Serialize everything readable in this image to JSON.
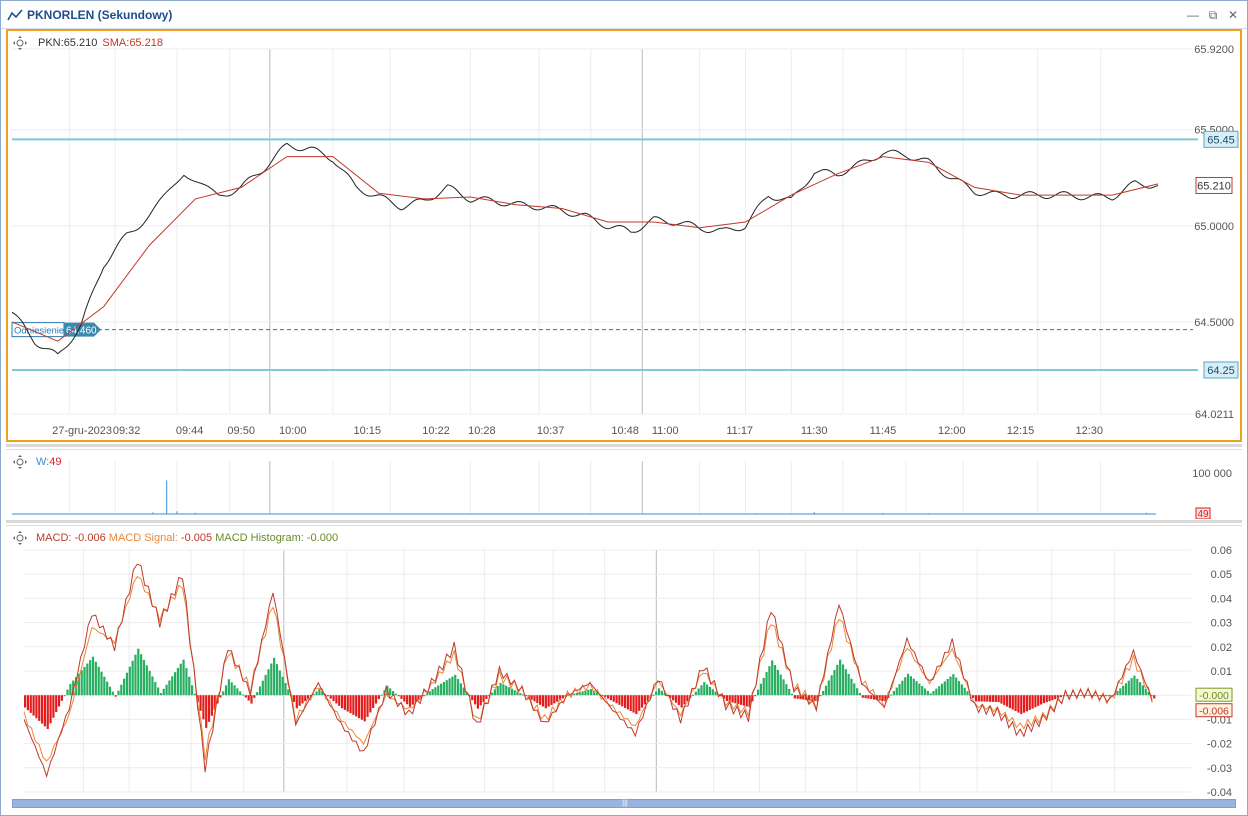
{
  "window": {
    "title": "PKNORLEN (Sekundowy)",
    "minimize": "—",
    "restore": "⧉",
    "close": "✕"
  },
  "colors": {
    "price_line": "#222222",
    "sma_line": "#c0392b",
    "hline": "#7ec8d8",
    "ref_line": "#2a7ab0",
    "panel_border": "#f0a020",
    "grid": "#ececec",
    "macd": "#c0392b",
    "signal": "#e8883a",
    "hist_pos": "#27ae60",
    "hist_neg": "#e31b1b",
    "volume": "#3a8fd8"
  },
  "price_panel": {
    "legend_pkn_label": "PKN:",
    "legend_pkn_value": "65.210",
    "legend_sma_label": "SMA:",
    "legend_sma_value": "65.218",
    "ref_label": "Odniesienie",
    "ref_value": "64.460",
    "hline_top_label": "65.45",
    "hline_bottom_label": "64.25",
    "last_price_label": "65.210",
    "y_ticks": [
      "65.9200",
      "65.5000",
      "65.0000",
      "64.5000",
      "64.0211"
    ],
    "x_ticks": [
      "27-gru-2023",
      "09:32",
      "09:44",
      "09:50",
      "10:00",
      "10:15",
      "10:22",
      "10:28",
      "10:37",
      "10:48",
      "11:00",
      "11:17",
      "11:30",
      "11:45",
      "12:00",
      "12:15",
      "12:30"
    ]
  },
  "volume_panel": {
    "legend_label": "W:",
    "legend_value": "49",
    "y_ticks": [
      "100 000",
      "0"
    ],
    "last_label": "49"
  },
  "macd_panel": {
    "macd_label": "MACD:",
    "macd_value": "-0.006",
    "signal_label": "MACD Signal:",
    "signal_value": "-0.005",
    "hist_label": "MACD Histogram:",
    "hist_value": "-0.000",
    "y_ticks": [
      "0.06",
      "0.05",
      "0.04",
      "0.03",
      "0.02",
      "0.01",
      "0",
      "-0.01",
      "-0.02",
      "-0.03",
      "-0.04"
    ],
    "hist_box_label": "-0.000",
    "macd_box_label": "-0.006"
  },
  "chart_data": {
    "type": "line",
    "title": "PKNORLEN (Sekundowy)",
    "x_categories": [
      "27-gru-2023",
      "09:32",
      "09:44",
      "09:50",
      "10:00",
      "10:15",
      "10:22",
      "10:28",
      "10:37",
      "10:48",
      "11:00",
      "11:17",
      "11:30",
      "11:45",
      "12:00",
      "12:15",
      "12:30"
    ],
    "ylim": [
      64.0211,
      65.92
    ],
    "horizontal_lines": [
      65.45,
      64.25
    ],
    "reference_line": 64.46,
    "series": [
      {
        "name": "PKN",
        "x": [
          0,
          2,
          4,
          6,
          8,
          10,
          12,
          15,
          18,
          20,
          22,
          24,
          26,
          28,
          30,
          32,
          34,
          36,
          38,
          40,
          42,
          44,
          46,
          48,
          50,
          52,
          54,
          56,
          58,
          60,
          62,
          64,
          66,
          68,
          70,
          72,
          74,
          76,
          78,
          80,
          82,
          84,
          86,
          88,
          90,
          92,
          94,
          96,
          98,
          100
        ],
        "values": [
          64.55,
          64.4,
          64.32,
          64.48,
          64.8,
          64.95,
          65.05,
          65.28,
          65.15,
          65.2,
          65.3,
          65.42,
          65.4,
          65.35,
          65.2,
          65.15,
          65.1,
          65.13,
          65.2,
          65.14,
          65.13,
          65.11,
          65.1,
          65.08,
          65.05,
          65.0,
          64.97,
          65.03,
          65.02,
          64.99,
          64.97,
          65.0,
          65.16,
          65.13,
          65.28,
          65.27,
          65.32,
          65.38,
          65.37,
          65.33,
          65.25,
          65.18,
          65.16,
          65.16,
          65.16,
          65.16,
          65.15,
          65.15,
          65.22,
          65.21
        ]
      },
      {
        "name": "SMA",
        "x": [
          0,
          4,
          8,
          12,
          16,
          20,
          24,
          28,
          32,
          36,
          40,
          44,
          48,
          52,
          56,
          60,
          64,
          68,
          72,
          76,
          80,
          84,
          88,
          92,
          96,
          100
        ],
        "values": [
          64.5,
          64.4,
          64.58,
          64.9,
          65.14,
          65.2,
          65.36,
          65.36,
          65.17,
          65.14,
          65.15,
          65.11,
          65.09,
          65.02,
          65.02,
          64.99,
          65.02,
          65.16,
          65.27,
          65.36,
          65.33,
          65.2,
          65.16,
          65.16,
          65.16,
          65.218
        ]
      }
    ],
    "volume": {
      "x": [
        0,
        10,
        12.3,
        13.5,
        14.4,
        16,
        20,
        30,
        40,
        50,
        58,
        65,
        70,
        76,
        80,
        90,
        99
      ],
      "values": [
        0,
        400,
        4000,
        82000,
        6500,
        3000,
        1500,
        1000,
        800,
        600,
        700,
        2000,
        4500,
        2500,
        2000,
        1200,
        3000
      ],
      "ylim": [
        0,
        100000
      ]
    },
    "macd": {
      "ylim": [
        -0.04,
        0.06
      ],
      "x": [
        0,
        2,
        4,
        6,
        8,
        10,
        12,
        14,
        16,
        18,
        20,
        22,
        24,
        26,
        28,
        30,
        32,
        34,
        36,
        38,
        40,
        42,
        44,
        46,
        48,
        50,
        52,
        54,
        56,
        58,
        60,
        62,
        64,
        66,
        68,
        70,
        72,
        74,
        76,
        78,
        80,
        82,
        84,
        86,
        88,
        90,
        92,
        94,
        96,
        98,
        100
      ],
      "macd": [
        -0.01,
        -0.033,
        -0.005,
        0.034,
        0.02,
        0.056,
        0.03,
        0.05,
        -0.03,
        0.02,
        0.001,
        0.043,
        -0.012,
        0.005,
        -0.012,
        -0.024,
        0.002,
        -0.008,
        0.005,
        0.02,
        -0.013,
        0.01,
        0.002,
        -0.012,
        0.0,
        0.005,
        -0.006,
        -0.016,
        0.007,
        -0.01,
        0.012,
        -0.004,
        -0.009,
        0.036,
        0.003,
        -0.005,
        0.038,
        0.005,
        -0.005,
        0.023,
        0.005,
        0.022,
        -0.005,
        -0.007,
        -0.016,
        -0.01,
        0.0,
        0.001,
        -0.002,
        0.018,
        -0.006
      ],
      "signal": [
        -0.008,
        -0.028,
        -0.008,
        0.028,
        0.022,
        0.05,
        0.032,
        0.046,
        -0.025,
        0.018,
        0.003,
        0.038,
        -0.01,
        0.004,
        -0.01,
        -0.02,
        0.0,
        -0.006,
        0.004,
        0.017,
        -0.011,
        0.008,
        0.002,
        -0.01,
        0.0,
        0.004,
        -0.005,
        -0.013,
        0.006,
        -0.008,
        0.01,
        -0.003,
        -0.007,
        0.031,
        0.004,
        -0.004,
        0.033,
        0.006,
        -0.004,
        0.02,
        0.005,
        0.019,
        -0.004,
        -0.006,
        -0.013,
        -0.009,
        0.0,
        0.001,
        -0.002,
        0.015,
        -0.005
      ]
    }
  }
}
